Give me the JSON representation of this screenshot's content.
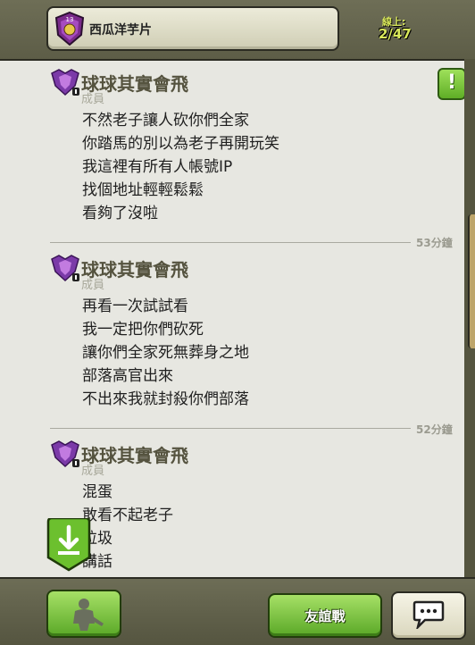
{
  "header": {
    "clan_name": "西瓜洋芋片",
    "clan_level": "13",
    "online_label": "線上:",
    "online_count": "2/47"
  },
  "messages": [
    {
      "sender": "球球其實會飛",
      "role": "成員",
      "lines": [
        "不然老子讓人砍你們全家",
        "你踏馬的別以為老子再開玩笑",
        "我這裡有所有人帳號IP",
        "找個地址輕輕鬆鬆",
        "看夠了沒啦"
      ]
    },
    {
      "timestamp": "53分鐘",
      "sender": "球球其實會飛",
      "role": "成員",
      "lines": [
        "再看一次試試看",
        "我一定把你們砍死",
        "讓你們全家死無葬身之地",
        "部落高官出來",
        "不出來我就封殺你們部落"
      ]
    },
    {
      "timestamp": "52分鐘",
      "sender": "球球其實會飛",
      "role": "成員",
      "lines": [
        "混蛋",
        "敢看不起老子",
        "垃圾",
        "講話"
      ]
    }
  ],
  "buttons": {
    "warn": "!",
    "friendly_war": "友誼戰"
  },
  "icons": {
    "clan_badge": "clan-badge-icon",
    "league_badge": "league-badge-icon",
    "download": "download-icon",
    "troops": "troops-icon",
    "chat": "chat-bubble-icon"
  },
  "colors": {
    "accent_green": "#6cc02e",
    "online_text": "#d8e85a",
    "chat_bg": "#e7e7e1",
    "sender_text": "#55533f"
  }
}
